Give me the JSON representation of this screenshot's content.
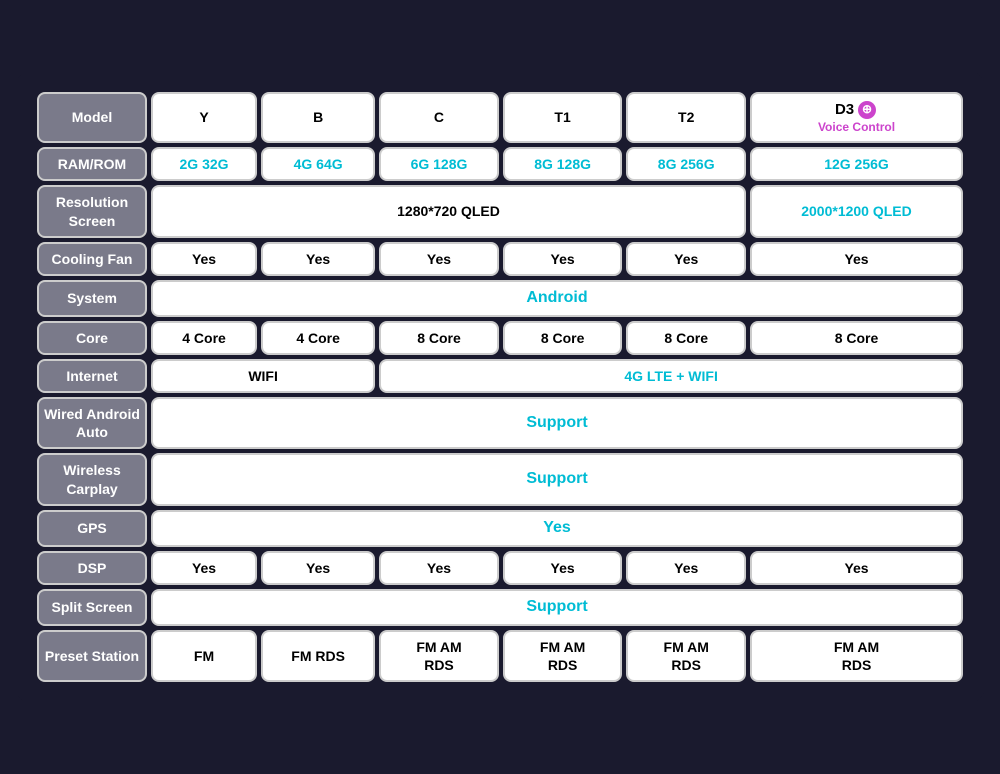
{
  "table": {
    "headers": {
      "model": "Model",
      "ram_rom": "RAM/ROM",
      "resolution": "Resolution\nScreen",
      "cooling_fan": "Cooling Fan",
      "system": "System",
      "core": "Core",
      "internet": "Internet",
      "wired_android": "Wired Android\nAuto",
      "wireless_carplay": "Wireless\nCarplay",
      "gps": "GPS",
      "dsp": "DSP",
      "split_screen": "Split Screen",
      "preset_station": "Preset Station"
    },
    "models": [
      "Y",
      "B",
      "C",
      "T1",
      "T2",
      "D3"
    ],
    "d3_label": "D3",
    "d3_subtitle": "Voice Control",
    "ram_rom": {
      "y": "2G 32G",
      "b": "4G 64G",
      "c": "6G 128G",
      "t1": "8G 128G",
      "t2": "8G 256G",
      "d3": "12G 256G"
    },
    "resolution_wide": "1280*720 QLED",
    "resolution_d3": "2000*1200 QLED",
    "cooling_fan": "Yes",
    "system": "Android",
    "cores": {
      "y": "4 Core",
      "b": "4 Core",
      "c": "8 Core",
      "t1": "8 Core",
      "t2": "8 Core",
      "d3": "8 Core"
    },
    "internet_wifi": "WIFI",
    "internet_lte": "4G LTE + WIFI",
    "wired_android": "Support",
    "wireless_carplay": "Support",
    "gps": "Yes",
    "dsp": "Yes",
    "split_screen": "Support",
    "preset_station": {
      "y": "FM",
      "b": "FM RDS",
      "c": "FM AM\nRDS",
      "t1": "FM AM\nRDS",
      "t2": "FM AM\nRDS",
      "d3": "FM AM\nRDS"
    }
  }
}
